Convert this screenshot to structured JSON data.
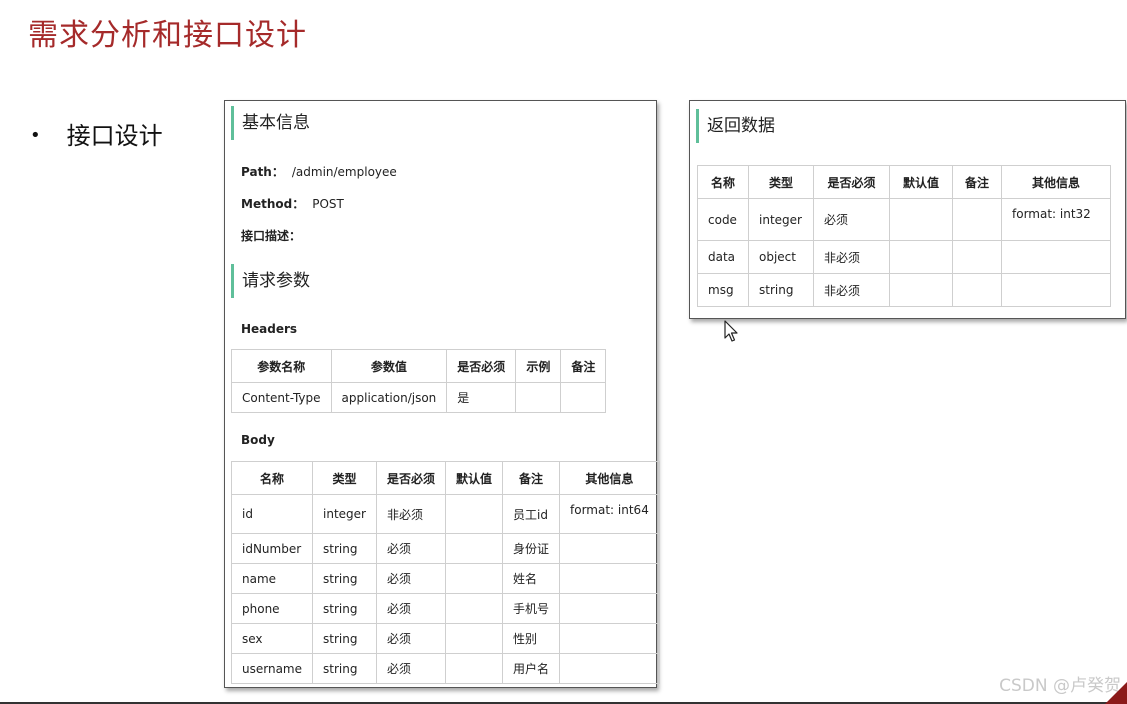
{
  "slide": {
    "title": "需求分析和接口设计",
    "bullet": "接口设计",
    "bullet_marker": "•"
  },
  "basic_info": {
    "heading": "基本信息",
    "path_label": "Path：",
    "path_value": "/admin/employee",
    "method_label": "Method：",
    "method_value": "POST",
    "desc_label": "接口描述："
  },
  "request": {
    "heading": "请求参数",
    "headers_label": "Headers",
    "headers_columns": [
      "参数名称",
      "参数值",
      "是否必须",
      "示例",
      "备注"
    ],
    "headers_rows": [
      [
        "Content-Type",
        "application/json",
        "是",
        "",
        ""
      ]
    ],
    "body_label": "Body",
    "body_columns": [
      "名称",
      "类型",
      "是否必须",
      "默认值",
      "备注",
      "其他信息"
    ],
    "body_rows": [
      [
        "id",
        "integer",
        "非必须",
        "",
        "员工id",
        "format: int64"
      ],
      [
        "idNumber",
        "string",
        "必须",
        "",
        "身份证",
        ""
      ],
      [
        "name",
        "string",
        "必须",
        "",
        "姓名",
        ""
      ],
      [
        "phone",
        "string",
        "必须",
        "",
        "手机号",
        ""
      ],
      [
        "sex",
        "string",
        "必须",
        "",
        "性别",
        ""
      ],
      [
        "username",
        "string",
        "必须",
        "",
        "用户名",
        ""
      ]
    ]
  },
  "response": {
    "heading": "返回数据",
    "columns": [
      "名称",
      "类型",
      "是否必须",
      "默认值",
      "备注",
      "其他信息"
    ],
    "rows": [
      [
        "code",
        "integer",
        "必须",
        "",
        "",
        "format: int32"
      ],
      [
        "data",
        "object",
        "非必须",
        "",
        "",
        ""
      ],
      [
        "msg",
        "string",
        "非必须",
        "",
        "",
        ""
      ]
    ]
  },
  "watermark": "CSDN @卢癸贺",
  "colors": {
    "title": "#a52a2a",
    "section_accent": "#5fbf9a",
    "corner": "#8b1a1a"
  },
  "icons": [
    "mouse-pointer-icon"
  ]
}
